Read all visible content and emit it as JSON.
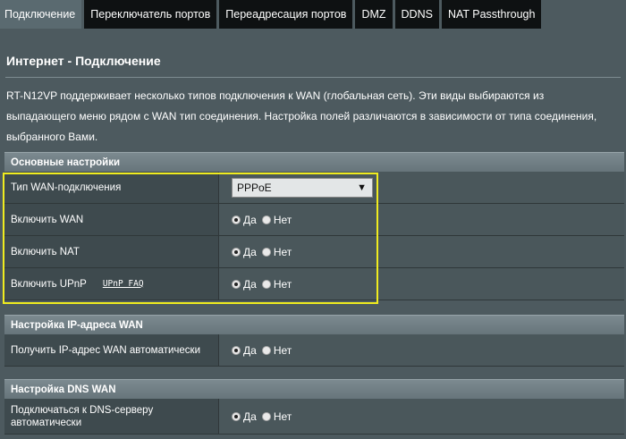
{
  "tabs": [
    {
      "label": "Подключение",
      "active": true
    },
    {
      "label": "Переключатель портов",
      "active": false
    },
    {
      "label": "Переадресация портов",
      "active": false
    },
    {
      "label": "DMZ",
      "active": false
    },
    {
      "label": "DDNS",
      "active": false
    },
    {
      "label": "NAT Passthrough",
      "active": false
    }
  ],
  "page_title": "Интернет - Подключение",
  "description": "RT-N12VP поддерживает несколько типов подключения к WAN (глобальная сеть). Эти виды выбираются из выпадающего меню рядом с WAN тип соединения. Настройка полей различаются в зависимости от типа соединения, выбранного Вами.",
  "basic": {
    "title": "Основные настройки",
    "wan_type_label": "Тип WAN-подключения",
    "wan_type_value": "PPPoE",
    "enable_wan_label": "Включить WAN",
    "enable_nat_label": "Включить NAT",
    "enable_upnp_label": "Включить UPnP",
    "upnp_faq": "UPnP FAQ"
  },
  "ip": {
    "title": "Настройка IP-адреса WAN",
    "auto_ip_label": "Получить IP-адрес WAN автоматически"
  },
  "dns": {
    "title": "Настройка DNS WAN",
    "auto_dns_label": "Подключаться к DNS-серверу автоматически"
  },
  "radio": {
    "yes": "Да",
    "no": "Нет"
  },
  "colors": {
    "highlight": "#f0ec1f",
    "tab_bg": "#0e1112",
    "body_bg": "#4d5a5f"
  }
}
